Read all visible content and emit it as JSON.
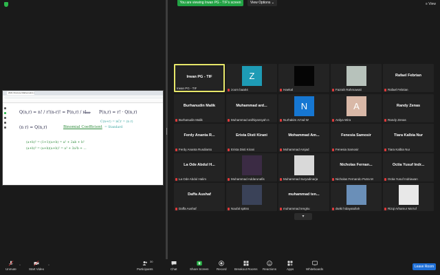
{
  "topbar": {
    "viewing_banner": "You are viewing Irwan PG - TIF's screen",
    "view_options": "View Options ⌄",
    "view_menu": "≡ View",
    "accent_green": "#22a244"
  },
  "shared_screen": {
    "browser_tab": "2021 Discrete Mathematics (B-2)",
    "handwriting": {
      "line1": "Q(n,r) = n! / r!(n-r)! = P(n,r) / r!",
      "arrow": "⟺",
      "line1_right": "P(n,r) = r! · Q(n,r)",
      "line2_left": "(n r) = Q(n,r)",
      "line2_mid": "Binomial Coefficient",
      "line2_note": "C(n+r) = nCr = (n r)",
      "line2_note2": "= Standard",
      "line3": "(a+b)² = (1+1)(a+b) = a² + 2ab + b²",
      "line4": "(a+b)³ = (a+b)(a+b)² = a³ + 3a²b + ..."
    }
  },
  "gallery": {
    "tiles": [
      {
        "name": "Irwan PG - TIF",
        "big": "Irwan PG - TIF",
        "muted": false,
        "active": true,
        "kind": "name"
      },
      {
        "name": "zoom baa04",
        "big": "",
        "muted": true,
        "kind": "avatar",
        "letter": "Z",
        "color": "#1e9bb5"
      },
      {
        "name": "Haekal",
        "big": "",
        "muted": true,
        "kind": "photo",
        "color": "#050505"
      },
      {
        "name": "Fazrah Rahmawati",
        "big": "",
        "muted": true,
        "kind": "photo",
        "color": "#b7c2bb"
      },
      {
        "name": "Rafael Febrian",
        "big": "Rafael Febrian",
        "muted": true,
        "kind": "name"
      },
      {
        "name": "Burhanudin Malik",
        "big": "Burhanudin Malik",
        "muted": true,
        "kind": "name"
      },
      {
        "name": "Muhammad ardhiyansyah n",
        "big": "Muhammad  ard...",
        "muted": true,
        "kind": "name"
      },
      {
        "name": "Nurhakim Az'ad W",
        "big": "",
        "muted": true,
        "kind": "avatar",
        "letter": "N",
        "color": "#1677d2"
      },
      {
        "name": "Ardya Wira",
        "big": "",
        "muted": true,
        "kind": "avatar",
        "letter": "A",
        "color": "#d9b8a7"
      },
      {
        "name": "Randy Zenas",
        "big": "Randy Zenas",
        "muted": true,
        "kind": "name"
      },
      {
        "name": "Ferdy Ananta Rusdianto",
        "big": "Ferdy Ananta  R...",
        "muted": true,
        "kind": "name"
      },
      {
        "name": "Erista Disti Kirani",
        "big": "Erista Disti Kirani",
        "muted": true,
        "kind": "name"
      },
      {
        "name": "Mohammad Amjad",
        "big": "Mohammad  Am...",
        "muted": true,
        "kind": "name"
      },
      {
        "name": "Fenesia Samosir",
        "big": "Fenesia Samosir",
        "muted": true,
        "kind": "name"
      },
      {
        "name": "Tiara Kalbia Nur",
        "big": "Tiara Kalbia Nur",
        "muted": true,
        "kind": "name"
      },
      {
        "name": "La Ode Abdul Halim",
        "big": "La Ode Abdul H...",
        "muted": true,
        "kind": "name"
      },
      {
        "name": "Muhammad Addarunafis",
        "big": "",
        "muted": true,
        "kind": "photo",
        "color": "#3b2b44"
      },
      {
        "name": "Muhammad Suryadinarja",
        "big": "",
        "muted": true,
        "kind": "photo",
        "color": "#d9d9d9"
      },
      {
        "name": "Nicholas Fernando Putra M",
        "big": "Nicholas  Fernan...",
        "muted": true,
        "kind": "name"
      },
      {
        "name": "Octia Yusuf Indriawan",
        "big": "Octia Yusuf Indr...",
        "muted": true,
        "kind": "name"
      },
      {
        "name": "Daffa Aushaf",
        "big": "Daffa Aushaf",
        "muted": true,
        "kind": "name"
      },
      {
        "name": "Naufal spttss",
        "big": "",
        "muted": true,
        "kind": "photo",
        "color": "#3a4258"
      },
      {
        "name": "muhammad tengku",
        "big": "muhammad  ten...",
        "muted": true,
        "kind": "name"
      },
      {
        "name": "dwiki hidayatullah",
        "big": "",
        "muted": true,
        "kind": "photo",
        "color": "#6a8fb8"
      },
      {
        "name": "Rizqi Arhamur Ma'ruf",
        "big": "",
        "muted": true,
        "kind": "photo",
        "color": "#e8e8e8"
      }
    ]
  },
  "toolbar": {
    "unmute": "Unmute",
    "start_video": "Start Video",
    "participants": "Participants",
    "participants_count": "30",
    "chat": "Chat",
    "share_screen": "Share Screen",
    "record": "Record",
    "breakout_rooms": "Breakout Rooms",
    "reactions": "Reactions",
    "apps": "Apps",
    "whiteboards": "Whiteboards",
    "leave_room": "Leave Room",
    "share_color": "#2db84c",
    "leave_color": "#1f6fd6"
  }
}
